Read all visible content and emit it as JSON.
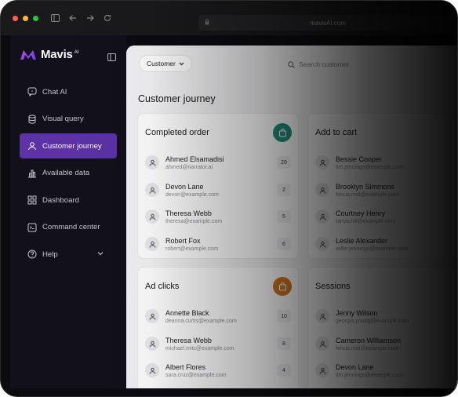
{
  "browser": {
    "url": "mavisAI.com",
    "traffic_lights": [
      "#ff5f57",
      "#febc2e",
      "#28c840"
    ]
  },
  "brand": {
    "name": "Mavis",
    "suffix": "AI",
    "accent": "#5e33a8"
  },
  "sidebar": {
    "items": [
      {
        "label": "Chat AI",
        "icon": "chat-icon",
        "active": false
      },
      {
        "label": "Visual query",
        "icon": "database-icon",
        "active": false
      },
      {
        "label": "Customer journey",
        "icon": "user-icon",
        "active": true
      },
      {
        "label": "Available data",
        "icon": "bar-chart-icon",
        "active": false
      },
      {
        "label": "Dashboard",
        "icon": "grid-icon",
        "active": false
      },
      {
        "label": "Command center",
        "icon": "terminal-icon",
        "active": false
      },
      {
        "label": "Help",
        "icon": "help-icon",
        "active": false
      }
    ]
  },
  "toolbar": {
    "filter_label": "Customer",
    "search_placeholder": "Search customer"
  },
  "page": {
    "title": "Customer journey"
  },
  "cards": [
    {
      "title": "Completed order",
      "badge_color": "#1f8f7a",
      "icon": "shopping-bag-icon",
      "rows": [
        {
          "name": "Ahmed Elsamadisi",
          "email": "ahmed@narrator.ai",
          "count": "20"
        },
        {
          "name": "Devon Lane",
          "email": "devon@example.com",
          "count": "2"
        },
        {
          "name": "Theresa Webb",
          "email": "theresa@example.com",
          "count": "5"
        },
        {
          "name": "Robert Fox",
          "email": "robert@example.com",
          "count": "6"
        }
      ]
    },
    {
      "title": "Add to cart",
      "badge_color": "#4a3a9c",
      "icon": "cart-icon",
      "rows": [
        {
          "name": "Bessie Cooper",
          "email": "tim.jennings@example.com",
          "count": ""
        },
        {
          "name": "Brooklyn Simmons",
          "email": "felicia.reid@example.com",
          "count": ""
        },
        {
          "name": "Courtney Henry",
          "email": "tanya.hill@example.com",
          "count": ""
        },
        {
          "name": "Leslie Alexander",
          "email": "willie.jennings@example.com",
          "count": ""
        }
      ]
    },
    {
      "title": "Ad clicks",
      "badge_color": "#d4761e",
      "icon": "shopping-bag-icon",
      "rows": [
        {
          "name": "Annette Black",
          "email": "deanna.curtis@example.com",
          "count": "10"
        },
        {
          "name": "Theresa Webb",
          "email": "michael.mitc@example.com",
          "count": "8"
        },
        {
          "name": "Albert Flores",
          "email": "sara.cruz@example.com",
          "count": "4"
        }
      ]
    },
    {
      "title": "Sessions",
      "badge_color": "#4a3a9c",
      "icon": "session-icon",
      "rows": [
        {
          "name": "Jenny Wilson",
          "email": "georgia.young@example.com",
          "count": ""
        },
        {
          "name": "Cameron Williamson",
          "email": "felicia.reid@example.com",
          "count": ""
        },
        {
          "name": "Devon Lane",
          "email": "tim.jennings@example.com",
          "count": ""
        }
      ]
    }
  ]
}
